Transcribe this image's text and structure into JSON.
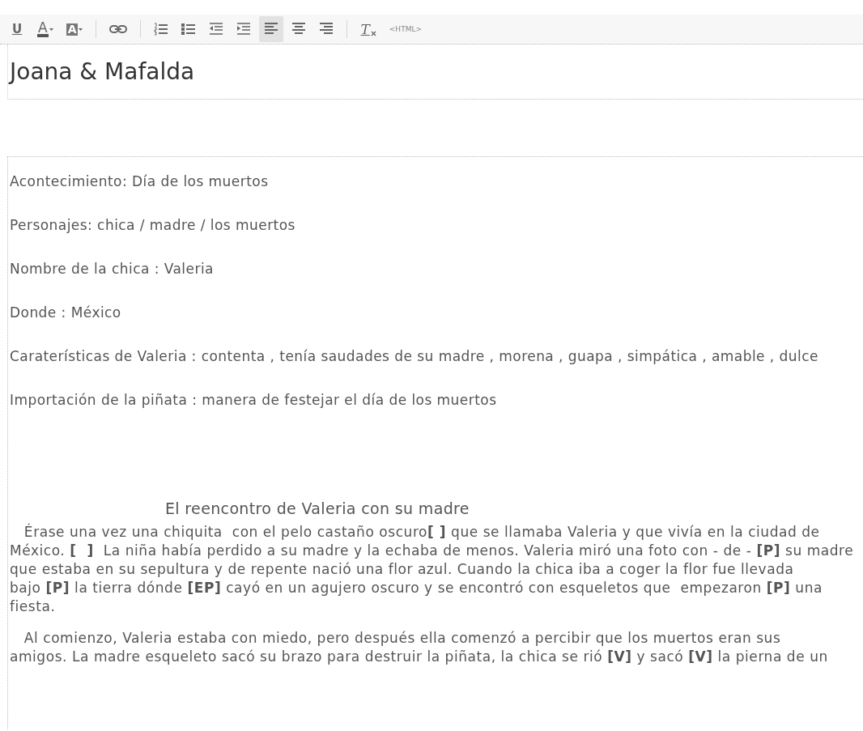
{
  "toolbar": [
    {
      "kind": "underline",
      "label": "U",
      "selected": false
    },
    {
      "kind": "font-color",
      "label": "A",
      "selected": false
    },
    {
      "kind": "bg-color",
      "label": "A",
      "selected": false
    },
    {
      "kind": "separator"
    },
    {
      "kind": "link",
      "selected": false
    },
    {
      "kind": "separator"
    },
    {
      "kind": "ordered-list",
      "selected": false
    },
    {
      "kind": "bullet-list",
      "selected": false
    },
    {
      "kind": "outdent",
      "selected": false
    },
    {
      "kind": "indent",
      "selected": false
    },
    {
      "kind": "align-left",
      "selected": true
    },
    {
      "kind": "align-center",
      "selected": false
    },
    {
      "kind": "align-right",
      "selected": false
    },
    {
      "kind": "separator"
    },
    {
      "kind": "clear-format",
      "label": "T",
      "selected": false
    },
    {
      "kind": "html",
      "label": "<HTML>",
      "selected": false
    }
  ],
  "title": {
    "value": "Joana & Mafalda"
  },
  "body": [
    {
      "kind": "line",
      "text": "Acontecimiento: Día de los muertos"
    },
    {
      "kind": "line",
      "text": "Personajes: chica / madre / los muertos"
    },
    {
      "kind": "line",
      "text": "Nombre de la chica :  Valeria"
    },
    {
      "kind": "line",
      "text": "Donde : México"
    },
    {
      "kind": "line",
      "text": "Caraterísticas de Valeria : contenta , tenía saudades de su madre , morena , guapa , simpática , amable , dulce"
    },
    {
      "kind": "line",
      "text": "Importación de la piñata : manera de festejar el día de los muertos"
    },
    {
      "kind": "heading",
      "text": "El reencontro de Valeria con su madre"
    },
    {
      "kind": "paragraph",
      "lines": [
        "   Érase una vez una chiquita  con el pelo castaño oscuro**[ ]** que se llamaba Valeria y que vivía en la ciudad de",
        "México. **[  ]**  La niña había perdido a su madre y la echaba de menos. Valeria miró una foto con - de - **[P]** su madre",
        "que estaba en su sepultura y de repente nació una flor azul. Cuando la chica iba a coger la flor fue llevada",
        "bajo **[P]** la tierra dónde **[EP]** cayó en un agujero oscuro y se encontró con esqueletos que  empezaron **[P]** una",
        "fiesta."
      ]
    },
    {
      "kind": "paragraph",
      "lines": [
        "   Al comienzo, Valeria estaba con miedo, pero después ella comenzó a percibir que los muertos eran sus",
        "amigos. La madre esqueleto sacó su brazo para destruir la piñata, la chica se rió **[V]** y sacó **[V]** la pierna de un"
      ]
    }
  ]
}
